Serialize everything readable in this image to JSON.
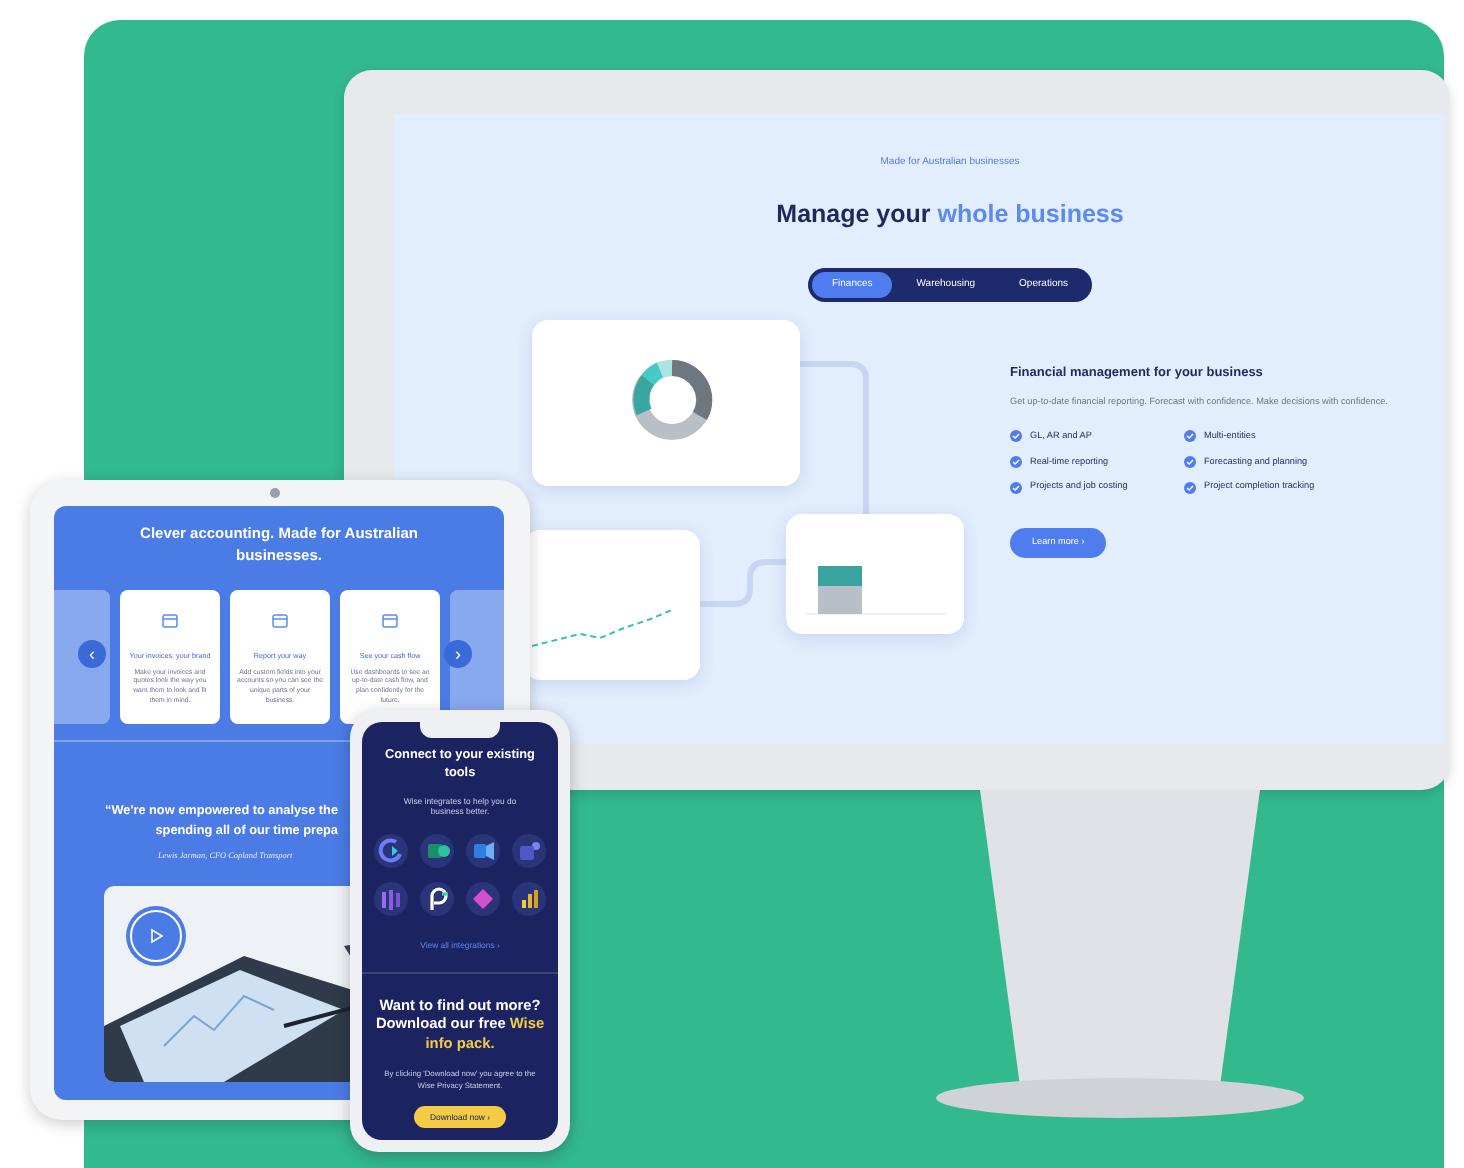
{
  "monitor": {
    "eyebrow": "Made for Australian businesses",
    "heading": {
      "start": "Manage your",
      "highlight": "whole business"
    },
    "tabs": [
      {
        "label": "Finances",
        "selected": true
      },
      {
        "label": "Warehousing",
        "selected": false
      },
      {
        "label": "Operations",
        "selected": false
      }
    ],
    "feature": {
      "title": "Financial management for your business",
      "description": "Get up-to-date financial reporting. Forecast with confidence. Make decisions with confidence.",
      "items": [
        {
          "label": "GL, AR and AP",
          "checked": true
        },
        {
          "label": "Multi-entities",
          "checked": true
        },
        {
          "label": "Real-time reporting",
          "checked": true
        },
        {
          "label": "Forecasting and planning",
          "checked": true
        },
        {
          "label": "Projects and job costing",
          "checked": true
        },
        {
          "label": "Project completion tracking",
          "checked": true
        }
      ],
      "button": "Learn more ›"
    }
  },
  "tablet": {
    "title": "Clever accounting. Made for Australian businesses.",
    "cards": [
      {
        "kind": "partial"
      },
      {
        "kind": "full",
        "title": "Your invoices, your brand",
        "body": "Make your invoices and quotes look the way you want them to look and fit them in mind."
      },
      {
        "kind": "full",
        "title": "Report your way",
        "body": "Add custom fields into your accounts so you can see the unique parts of your business."
      },
      {
        "kind": "full",
        "title": "See your cash flow",
        "body": "Use dashboards to see an up-to-date cash flow, and plan confidently for the future."
      },
      {
        "kind": "partial"
      }
    ],
    "prev": "‹",
    "next": "›",
    "quote": "“We're now empowered to analyse the\nspending all of our time prepa",
    "attribution": "Lewis Jarman, CFO Copland Transport"
  },
  "phone": {
    "title": "Connect to your existing tools",
    "subtitle": "Wise integrates to help you do business better.",
    "link": "View all integrations ›",
    "cta": {
      "start": "Want to find out more? Download our free",
      "highlight": "Wise info pack."
    },
    "note": "By clicking 'Download now' you agree to the Wise Privacy Statement.",
    "button": "Download now ›"
  }
}
